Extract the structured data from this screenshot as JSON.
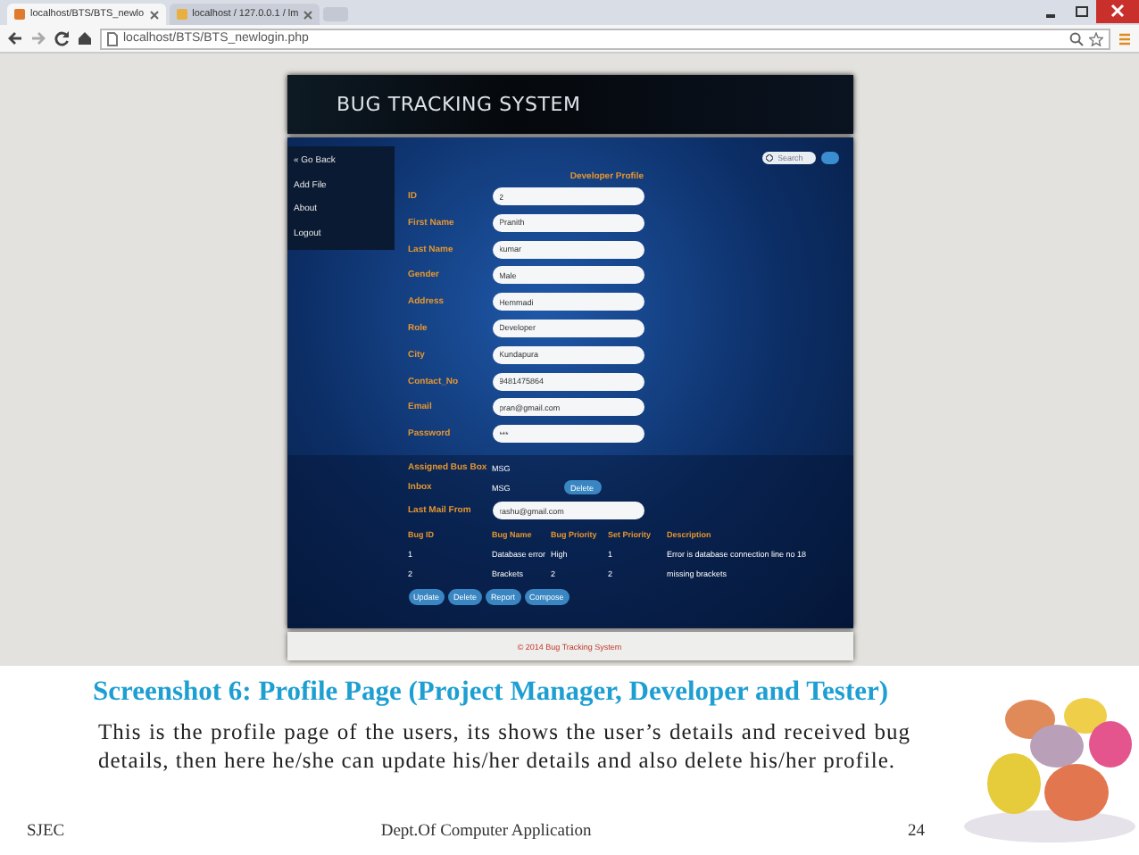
{
  "browser": {
    "tabs": [
      {
        "title": "localhost/BTS/BTS_newlo",
        "selected": true
      },
      {
        "title": "localhost / 127.0.0.1 / lm",
        "selected": false
      }
    ],
    "address": "localhost/BTS/BTS_newlogin.php"
  },
  "site": {
    "title": "BUG TRACKING SYSTEM",
    "sidebar": [
      "« Go Back",
      "Add File",
      "About",
      "Logout"
    ],
    "search": {
      "placeholder": "Search"
    },
    "profile_title": "Developer Profile",
    "fields": [
      {
        "label": "ID",
        "value": "2"
      },
      {
        "label": "First Name",
        "value": "Pranith"
      },
      {
        "label": "Last Name",
        "value": "kumar"
      },
      {
        "label": "Gender",
        "value": "Male"
      },
      {
        "label": "Address",
        "value": "Hemmadi"
      },
      {
        "label": "Role",
        "value": "Developer"
      },
      {
        "label": "City",
        "value": "Kundapura"
      },
      {
        "label": "Contact_No",
        "value": "9481475864"
      },
      {
        "label": "Email",
        "value": "pran@gmail.com"
      },
      {
        "label": "Password",
        "value": "***"
      }
    ],
    "assigned": {
      "label": "Assigned Bus Box",
      "value": "MSG"
    },
    "inbox": {
      "label": "Inbox",
      "value": "MSG",
      "button": "Delete"
    },
    "last_mail": {
      "label": "Last Mail From",
      "value": "rashu@gmail.com"
    },
    "table": {
      "columns": [
        "Bug ID",
        "Bug Name",
        "Bug Priority",
        "Set Priority",
        "Description"
      ],
      "rows": [
        [
          "1",
          "Database error",
          "High",
          "1",
          "Error is database connection line no 18"
        ],
        [
          "2",
          "Brackets",
          "2",
          "2",
          "missing brackets"
        ]
      ]
    },
    "buttons": [
      "Update",
      "Delete",
      "Report",
      "Compose"
    ],
    "footer": "© 2014 Bug Tracking System"
  },
  "slide": {
    "caption": "Screenshot 6: Profile Page (Project Manager, Developer and Tester)",
    "text": "This is the profile page of the users, its shows the user’s details and received bug details, then here he/she can update his/her details and also delete his/her profile.",
    "footer": [
      "SJEC",
      "Dept.Of Computer Application",
      "24"
    ]
  }
}
